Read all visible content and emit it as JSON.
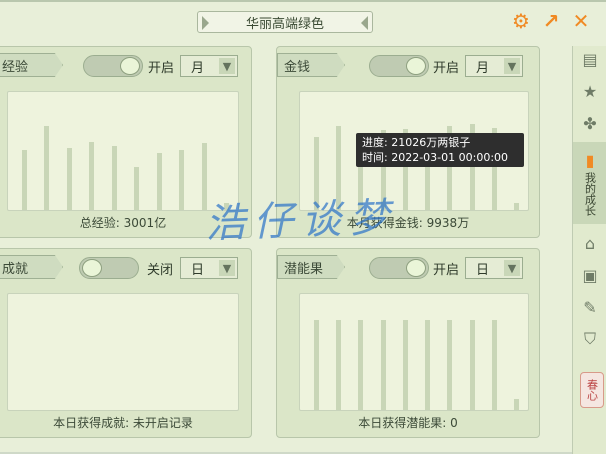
{
  "window": {
    "title": "华丽高端绿色"
  },
  "panels": {
    "exp": {
      "tag": "经验",
      "toggle_label": "开启",
      "toggle_on": true,
      "period": "月",
      "bars": [
        0.54,
        0.75,
        0.55,
        0.61,
        0.57,
        0.38,
        0.51,
        0.54,
        0.6,
        0.06
      ],
      "footer": "总经验: 3001亿"
    },
    "money": {
      "tag": "金钱",
      "toggle_label": "开启",
      "toggle_on": true,
      "period": "月",
      "bars": [
        0.65,
        0.75,
        0.53,
        0.71,
        0.72,
        0.57,
        0.75,
        0.77,
        0.73,
        0.06
      ],
      "footer": "本月获得金钱: 9938万"
    },
    "achieve": {
      "tag": "成就",
      "toggle_label": "关闭",
      "toggle_on": false,
      "period": "日",
      "bars": [],
      "footer": "本日获得成就: 未开启记录"
    },
    "potential": {
      "tag": "潜能果",
      "toggle_label": "开启",
      "toggle_on": true,
      "period": "日",
      "bars": [
        0.82,
        0.82,
        0.82,
        0.82,
        0.82,
        0.82,
        0.82,
        0.82,
        0.82,
        0.1
      ],
      "footer": "本日获得潜能果: 0"
    }
  },
  "tooltip": {
    "line1": "进度: 21026万两银子",
    "line2": "时间: 2022-03-01 00:00:00"
  },
  "sidebar": {
    "active_label": "我的成长",
    "spring_label": "春心"
  },
  "watermark": "浩仔谈梦",
  "colors": {
    "accent": "#f08a24",
    "panel": "#dbe6c8",
    "bar": "#c9d6b7"
  }
}
